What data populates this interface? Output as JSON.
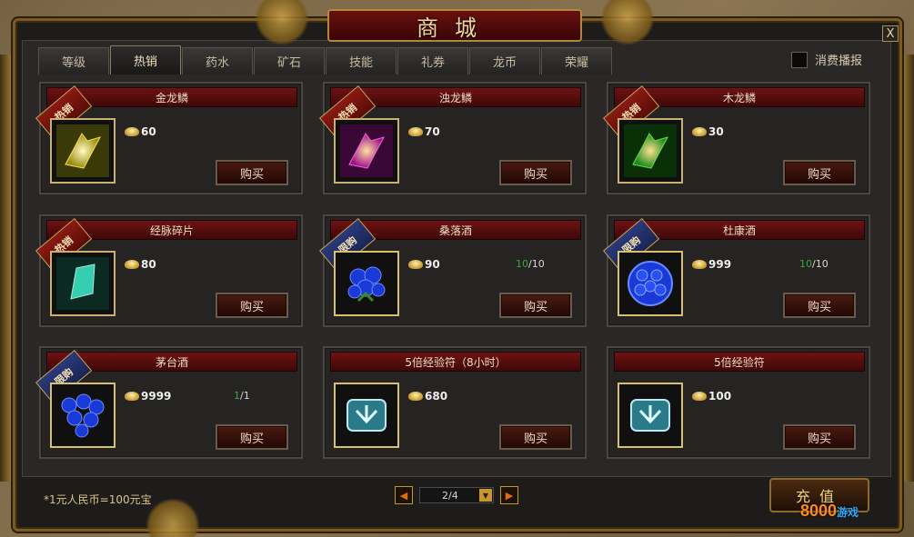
{
  "title": "商城",
  "close_label": "X",
  "tabs": [
    {
      "label": "等级"
    },
    {
      "label": "热销"
    },
    {
      "label": "药水"
    },
    {
      "label": "矿石"
    },
    {
      "label": "技能"
    },
    {
      "label": "礼券"
    },
    {
      "label": "龙币"
    },
    {
      "label": "荣耀"
    }
  ],
  "active_tab": "热销",
  "broadcast_checkbox": {
    "label": "消费播报",
    "checked": false
  },
  "items": [
    {
      "name": "金龙鳞",
      "badge": "热销",
      "badge_type": "hot",
      "price": "60",
      "limit_cur": "",
      "limit_max": "",
      "buy": "购买",
      "icon": "gold-scale-icon"
    },
    {
      "name": "浊龙鳞",
      "badge": "热销",
      "badge_type": "hot",
      "price": "70",
      "limit_cur": "",
      "limit_max": "",
      "buy": "购买",
      "icon": "purple-scale-icon"
    },
    {
      "name": "木龙鳞",
      "badge": "热销",
      "badge_type": "hot",
      "price": "30",
      "limit_cur": "",
      "limit_max": "",
      "buy": "购买",
      "icon": "green-scale-icon"
    },
    {
      "name": "经脉碎片",
      "badge": "热销",
      "badge_type": "hot",
      "price": "80",
      "limit_cur": "",
      "limit_max": "",
      "buy": "购买",
      "icon": "crystal-shard-icon"
    },
    {
      "name": "桑落酒",
      "badge": "限购",
      "badge_type": "limit",
      "price": "90",
      "limit_cur": "10",
      "limit_max": "/10",
      "buy": "购买",
      "icon": "blue-flower-bouquet-icon"
    },
    {
      "name": "杜康酒",
      "badge": "限购",
      "badge_type": "limit",
      "price": "999",
      "limit_cur": "10",
      "limit_max": "/10",
      "buy": "购买",
      "icon": "blue-rose-ball-icon"
    },
    {
      "name": "茅台酒",
      "badge": "限购",
      "badge_type": "limit",
      "price": "9999",
      "limit_cur": "1",
      "limit_max": "/1",
      "buy": "购买",
      "icon": "blue-rose-bunch-icon"
    },
    {
      "name": "5倍经验符（8小时）",
      "badge": "",
      "badge_type": "",
      "price": "680",
      "limit_cur": "",
      "limit_max": "",
      "buy": "购买",
      "icon": "exp-scroll-icon"
    },
    {
      "name": "5倍经验符",
      "badge": "",
      "badge_type": "",
      "price": "100",
      "limit_cur": "",
      "limit_max": "",
      "buy": "购买",
      "icon": "exp-scroll-icon"
    }
  ],
  "footnote": "*1元人民币=100元宝",
  "pager": {
    "current": "2/4",
    "prev": "◀",
    "next": "▶",
    "drop": "▼"
  },
  "recharge_label": "充值",
  "watermark": {
    "main": "8000",
    "sub": "游戏"
  },
  "colors": {
    "accent_red": "#6e1212",
    "gold": "#c8962a",
    "limit_green": "#3ea83e",
    "hot_ribbon": "#8a1a12",
    "limit_ribbon": "#2a3a7a"
  }
}
